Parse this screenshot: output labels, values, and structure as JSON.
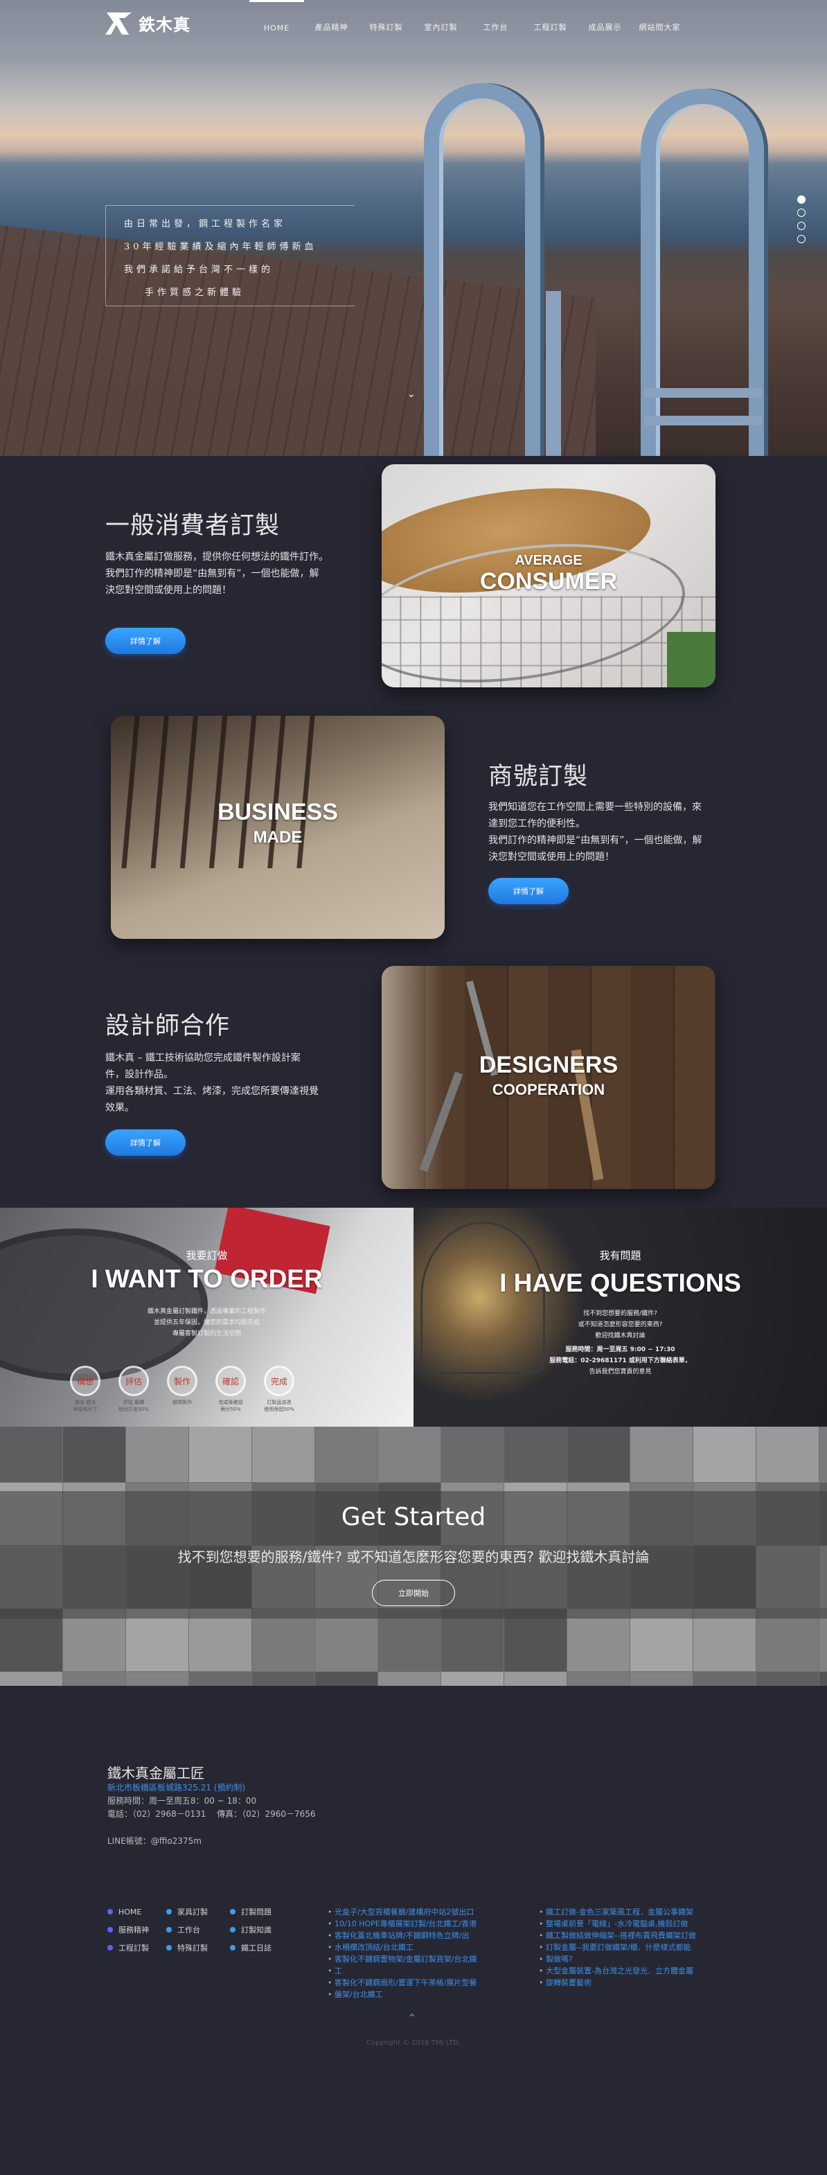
{
  "nav": {
    "logo": "鉄木真",
    "items": [
      "HOME",
      "產品精神",
      "特殊訂製",
      "室內訂製",
      "工作台",
      "工程訂製",
      "成品展示",
      "網站問大家"
    ],
    "active": 0
  },
  "hero": {
    "quote": [
      "由日常出發，鋼工程製作名家",
      "30年經驗業績及縮內年輕師傅新血",
      "我們承諾給予台灣不一樣的",
      "手作質感之新體驗"
    ],
    "slides": 4,
    "current_slide": 0,
    "scroll_icon": "chevron-down-icon"
  },
  "sections": {
    "consumer": {
      "title": "一般消費者訂製",
      "text": [
        "鐵木真金屬訂做服務，提供你任何想法的鐵件訂作。",
        "我們訂作的精神即是“由無到有”，一個也能做，解",
        "決您對空間或使用上的問題！"
      ],
      "button": "詳情了解",
      "caption_small": "AVERAGE",
      "caption_big": "CONSUMER"
    },
    "business": {
      "title": "商號訂製",
      "text": [
        "我們知道您在工作空間上需要一些特別的設備，來",
        "達到您工作的便利性。",
        "我們訂作的精神即是“由無到有”，一個也能做，解",
        "決您對空間或使用上的問題！"
      ],
      "button": "詳情了解",
      "caption_big": "BUSINESS",
      "caption_small": "MADE"
    },
    "designer": {
      "title": "設計師合作",
      "text": [
        "鐵木真 – 鐵工技術協助您完成鐵件製作設計案",
        "件，設計作品。",
        "運用各類材質、工法、烤漆，完成您所要傳達視覺",
        "效果。"
      ],
      "button": "詳情了解",
      "caption_big": "DESIGNERS",
      "caption_small": "COOPERATION"
    }
  },
  "order": {
    "small": "我要訂做",
    "big": "I WANT TO ORDER",
    "lines": [
      "鐵木真金屬訂製鐵件，透過專業的工程製作",
      "並提供五年保固，讓您的需求均能完成",
      "專屬客製訂製的生活空間"
    ],
    "steps": [
      {
        "label": "構想",
        "desc": "提出 想法\n與規格尺寸"
      },
      {
        "label": "評估",
        "desc": "評估 報價\n給付訂金50%"
      },
      {
        "label": "製作",
        "desc": "按時製作"
      },
      {
        "label": "確認",
        "desc": "完成後確認\n再付50%"
      },
      {
        "label": "完成",
        "desc": "訂製品送達\n使用保固50%"
      }
    ]
  },
  "questions": {
    "small": "我有問題",
    "big": "I HAVE QUESTIONS",
    "lines": [
      "找不到您想要的服務/鐵件?",
      "或不知道怎麼形容您要的東西?",
      "歡迎找鐵木真討論",
      "服務時間：周一至周五 9:00 ~ 17:30",
      "服務電話：02-29681171 或利用下方聯絡表單，",
      "告訴我們您寶貴的意見"
    ]
  },
  "get_started": {
    "title": "Get Started",
    "subtitle": "找不到您想要的服務/鐵件? 或不知道怎麼形容您要的東西? 歡迎找鐵木真討論",
    "button": "立即開始"
  },
  "footer": {
    "company": "鐵木真金屬工匠",
    "address": "新北市板橋區板城路325.21 (預約制)",
    "hours": "服務時間：周一至周五8：00 ~ 18：00",
    "phone": "電話：（02）2968－0131　 傳真：（02）2960－7656",
    "line": "LINE帳號：@ffio2375m",
    "nav": [
      {
        "label": "HOME",
        "color": "#5b63ff"
      },
      {
        "label": "家具訂製",
        "color": "#3d9cf0"
      },
      {
        "label": "訂製問題",
        "color": "#3d9cf0"
      },
      {
        "label": "服務精神",
        "color": "#5b63ff"
      },
      {
        "label": "工作台",
        "color": "#3d9cf0"
      },
      {
        "label": "訂製知識",
        "color": "#3d9cf0"
      },
      {
        "label": "工程訂製",
        "color": "#5b63ff"
      },
      {
        "label": "特殊訂製",
        "color": "#3d9cf0"
      },
      {
        "label": "鐵工日誌",
        "color": "#3d9cf0"
      }
    ],
    "links_a": [
      "光盒子/大型貨櫃餐廳/建構府中站2號出口",
      "10/10 HOPE專櫃展架訂製/台北鐵工/香港",
      "客製化蓋北機車站牌/不鏽鋼特色立牌/出",
      "水柵欄改頂結/台北鐵工",
      "客製化不鏽鋼置物架/金屬訂製貨架/台北鐵",
      "工",
      "客製化不鏽鋼扇形/置運下午茶帳/展片型餐",
      "盤架/台北鐵工"
    ],
    "links_b": [
      "鐵工訂做-金色三家築風工程．金屬公事鐵架",
      "整場桌前景「電線」-水冷電腦桌,機殼訂做",
      "鐵工製做結做伸縮架--搭裡布賣飛費鐵架訂做",
      "訂製金屬--我要訂做鐵架/櫃．什麼樣式都能",
      "製做嗎?",
      "大型金屬裝置-為台灣之光發光．立方體金屬",
      "旋轉裝置藝術"
    ],
    "up_icon": "chevron-up-icon",
    "copyright": "Copyright © 2016 TMJ LTD."
  }
}
